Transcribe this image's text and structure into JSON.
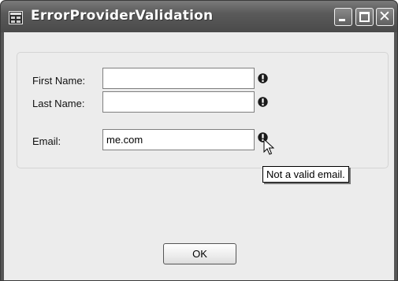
{
  "window": {
    "title": "ErrorProviderValidation",
    "controls": {
      "minimize_icon": "minimize-icon",
      "maximize_icon": "maximize-icon",
      "close_label": "✕"
    }
  },
  "form": {
    "first_name": {
      "label": "First Name:",
      "value": ""
    },
    "last_name": {
      "label": "Last Name:",
      "value": ""
    },
    "email": {
      "label": "Email:",
      "value": "me.com"
    }
  },
  "error_tooltip": {
    "text": "Not a valid email."
  },
  "ok_button": {
    "label": "OK"
  },
  "colors": {
    "titlebar": "#5a5a5a",
    "client_background": "#ececec",
    "error_icon": "#1a1a1a"
  }
}
